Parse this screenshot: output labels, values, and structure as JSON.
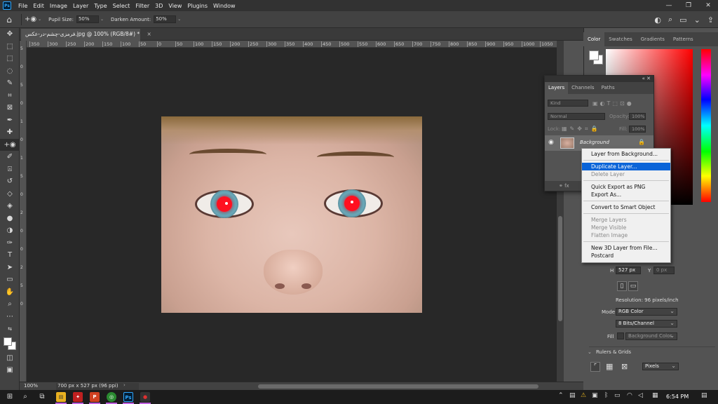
{
  "menubar": {
    "items": [
      "File",
      "Edit",
      "Image",
      "Layer",
      "Type",
      "Select",
      "Filter",
      "3D",
      "View",
      "Plugins",
      "Window"
    ],
    "window_controls": [
      "—",
      "❐",
      "✕"
    ]
  },
  "options": {
    "pupil_size_label": "Pupil Size:",
    "pupil_size_value": "50%",
    "darken_amount_label": "Darken Amount:",
    "darken_amount_value": "50%"
  },
  "document": {
    "tab_title": "فرمزی-چشم-در-عکس.jpg @ 100% (RGB/8#) *",
    "close": "×",
    "zoom": "100%",
    "dimensions": "700 px x 527 px (96 ppi)"
  },
  "ruler_h": [
    "350",
    "300",
    "250",
    "200",
    "150",
    "100",
    "50",
    "0",
    "50",
    "100",
    "150",
    "200",
    "250",
    "300",
    "350",
    "400",
    "450",
    "500",
    "550",
    "600",
    "650",
    "700",
    "750",
    "800",
    "850",
    "900",
    "950",
    "1000",
    "1050"
  ],
  "ruler_v": [
    "5",
    "0",
    "5",
    "0",
    "1",
    "0",
    "1",
    "5",
    "0",
    "2",
    "0",
    "0",
    "2",
    "5",
    "0"
  ],
  "color_panel": {
    "tabs": [
      "Color",
      "Swatches",
      "Gradients",
      "Patterns"
    ]
  },
  "layers_panel": {
    "tabs": [
      "Layers",
      "Channels",
      "Paths"
    ],
    "kind_placeholder": "Kind",
    "blend_mode": "Normal",
    "opacity_label": "Opacity:",
    "opacity_value": "100%",
    "lock_label": "Lock:",
    "fill_label": "Fill:",
    "fill_value": "100%",
    "layer_name": "Background",
    "footer_icons": "⚭  fx"
  },
  "context_menu": {
    "groups": [
      [
        {
          "label": "Layer from Background...",
          "disabled": false
        }
      ],
      [
        {
          "label": "Duplicate Layer...",
          "disabled": false,
          "highlight": true
        },
        {
          "label": "Delete Layer",
          "disabled": true
        }
      ],
      [
        {
          "label": "Quick Export as PNG",
          "disabled": false
        },
        {
          "label": "Export As...",
          "disabled": false
        }
      ],
      [
        {
          "label": "Convert to Smart Object",
          "disabled": false
        }
      ],
      [
        {
          "label": "Merge Layers",
          "disabled": true
        },
        {
          "label": "Merge Visible",
          "disabled": true
        },
        {
          "label": "Flatten Image",
          "disabled": true
        }
      ],
      [
        {
          "label": "New 3D Layer from File...",
          "disabled": false
        },
        {
          "label": "Postcard",
          "disabled": false
        }
      ]
    ]
  },
  "properties": {
    "h_label": "H",
    "h_value": "527 px",
    "y_label": "Y",
    "y_value": "0 px",
    "resolution": "Resolution: 96 pixels/inch",
    "mode_label": "Mode",
    "mode_value": "RGB Color",
    "depth_value": "8 Bits/Channel",
    "fill_label": "Fill",
    "fill_value": "Background Color",
    "rulers_section": "Rulers & Grids",
    "units_value": "Pixels"
  },
  "taskbar": {
    "time": "6:54 PM"
  },
  "colors": {
    "accent": "#0a64d8",
    "redeye": "#ff1020"
  }
}
